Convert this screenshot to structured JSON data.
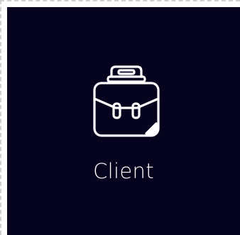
{
  "card": {
    "label": "Client",
    "icon": "briefcase-icon"
  },
  "colors": {
    "card_background": "#06031f",
    "foreground": "#ffffff"
  }
}
